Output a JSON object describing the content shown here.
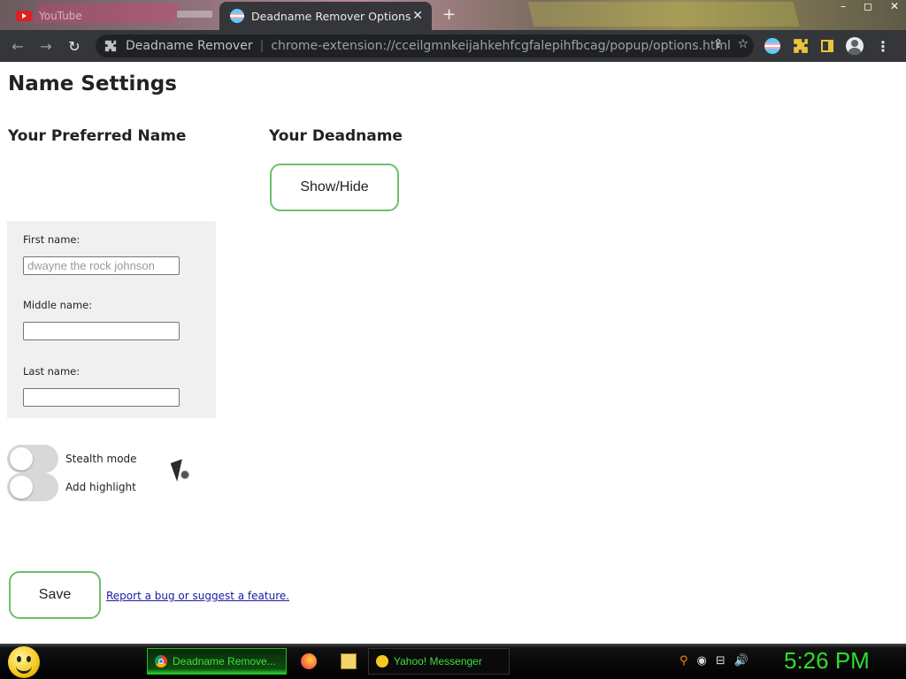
{
  "browser": {
    "inactive_tab_label": "YouTube",
    "active_tab_title": "Deadname Remover Options",
    "close_glyph": "✕",
    "new_tab_glyph": "+",
    "window_controls": [
      "–",
      "◻",
      "✕"
    ],
    "omnibox": {
      "site_name": "Deadname Remover",
      "url": "chrome-extension://cceilgmnkeijahkehfcgfalepihfbcag/popup/options.html"
    },
    "toolbar_glyphs": {
      "back": "←",
      "forward": "→",
      "reload": "↻",
      "share": "⇪",
      "star": "☆",
      "menu": "⋮"
    }
  },
  "page": {
    "title": "Name Settings",
    "preferred_heading": "Your Preferred Name",
    "deadname_heading": "Your Deadname",
    "show_hide_label": "Show/Hide",
    "fields": {
      "first": {
        "label": "First name:",
        "placeholder": "dwayne the rock johnson",
        "value": ""
      },
      "middle": {
        "label": "Middle name:",
        "value": ""
      },
      "last": {
        "label": "Last name:",
        "value": ""
      }
    },
    "toggles": {
      "stealth": {
        "label": "Stealth mode",
        "on": false
      },
      "highlight": {
        "label": "Add highlight",
        "on": false
      }
    },
    "save_label": "Save",
    "report_link": "Report a bug or suggest a feature."
  },
  "taskbar": {
    "chrome_task": "Deadname Remove...",
    "yahoo_task": "Yahoo! Messenger",
    "clock": "5:26 PM",
    "tray_glyphs": {
      "search": "⚲",
      "network": "⊟",
      "volume": "🔊"
    }
  },
  "colors": {
    "accent_green_border": "#6cbf6c",
    "clock_green": "#2fdc2f",
    "link_blue": "#1a1aa6",
    "browser_dark": "#35363a"
  }
}
